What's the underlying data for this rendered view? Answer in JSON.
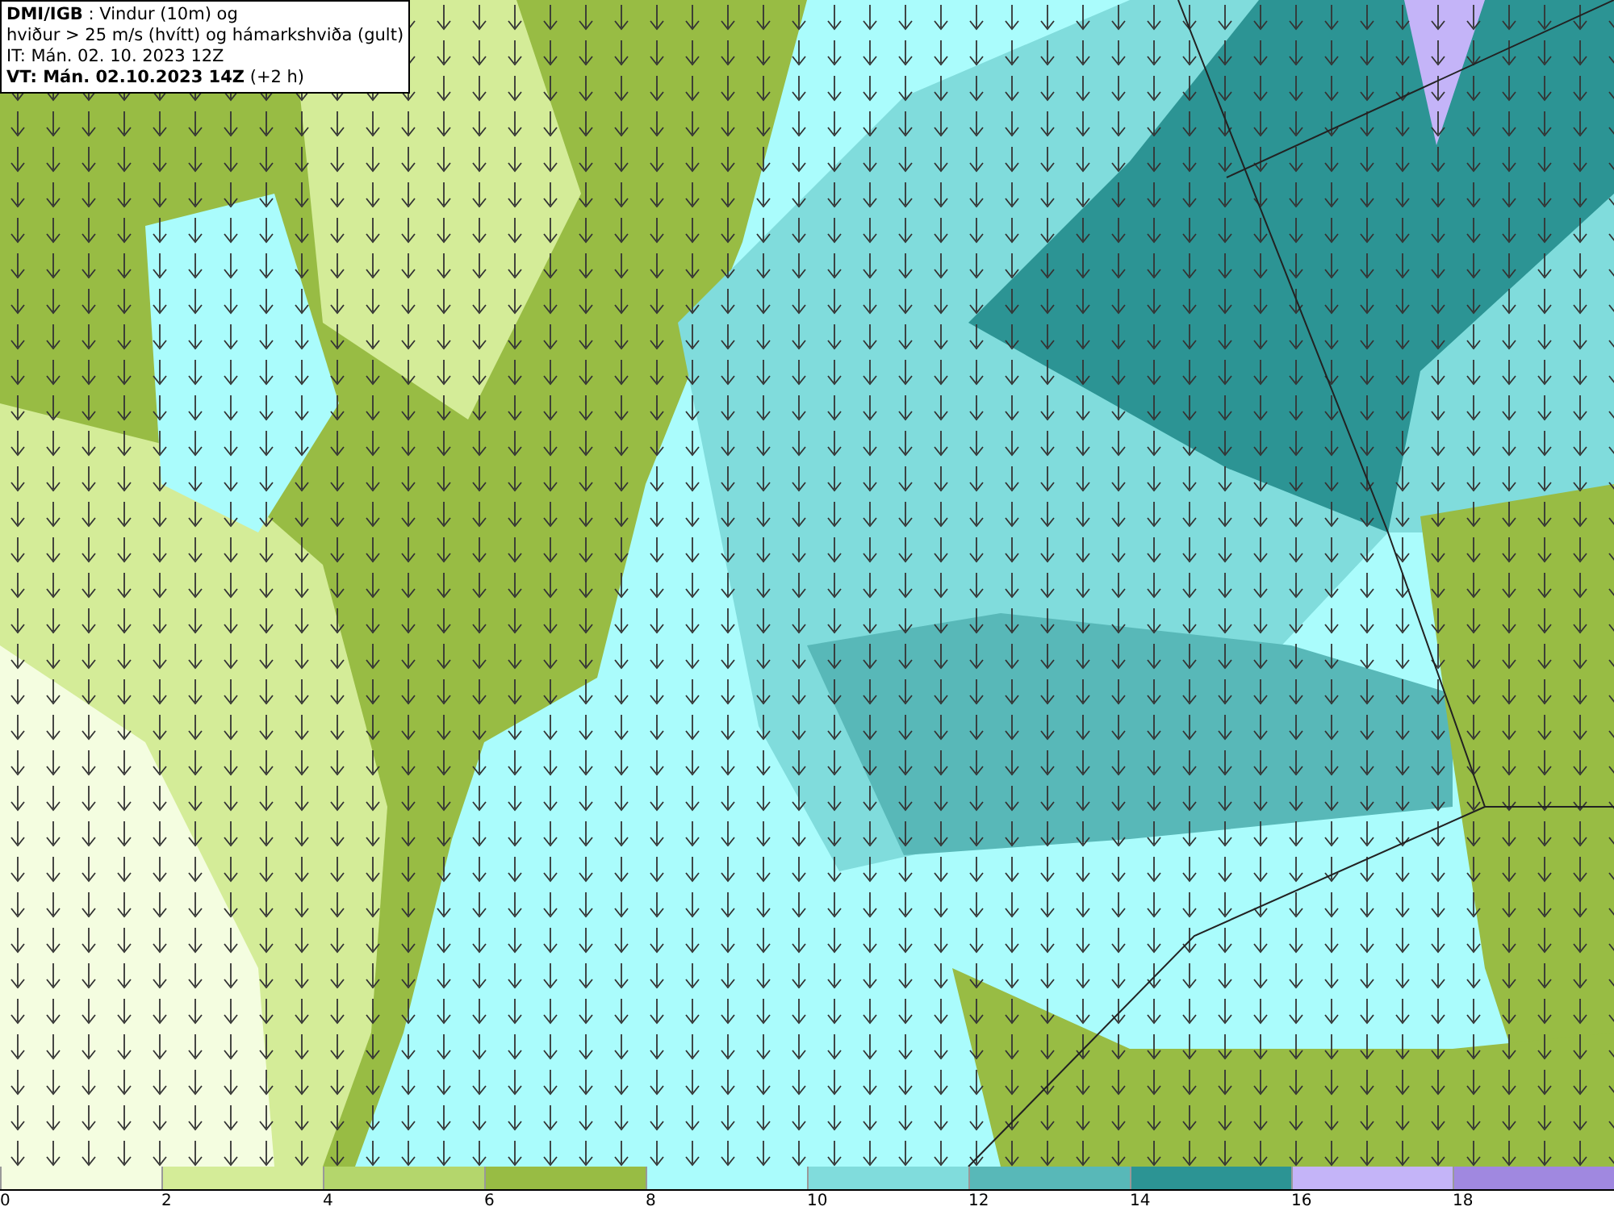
{
  "info_box": {
    "lines": [
      "**DMI/IGB** : Vindur (10m) og",
      "hviður > 25 m/s (hvítt) og hámarkshviða (gult)",
      "IT: Mán. 02. 10. 2023 12Z",
      "**VT: Mán. 02.10.2023 14Z** (+2 h)"
    ]
  },
  "legend": {
    "segments": [
      {
        "color": "#f4fde0"
      },
      {
        "color": "#d4ec98"
      },
      {
        "color": "#b4d66c"
      },
      {
        "color": "#98bc44"
      },
      {
        "color": "#aafcfc"
      },
      {
        "color": "#80dcdc"
      },
      {
        "color": "#58b8b8"
      },
      {
        "color": "#2c9494"
      },
      {
        "color": "#c4b4f8"
      },
      {
        "color": "#a088e0"
      }
    ],
    "labels": [
      "0",
      "2",
      "4",
      "6",
      "8",
      "10",
      "12",
      "14",
      "16",
      "18"
    ]
  }
}
